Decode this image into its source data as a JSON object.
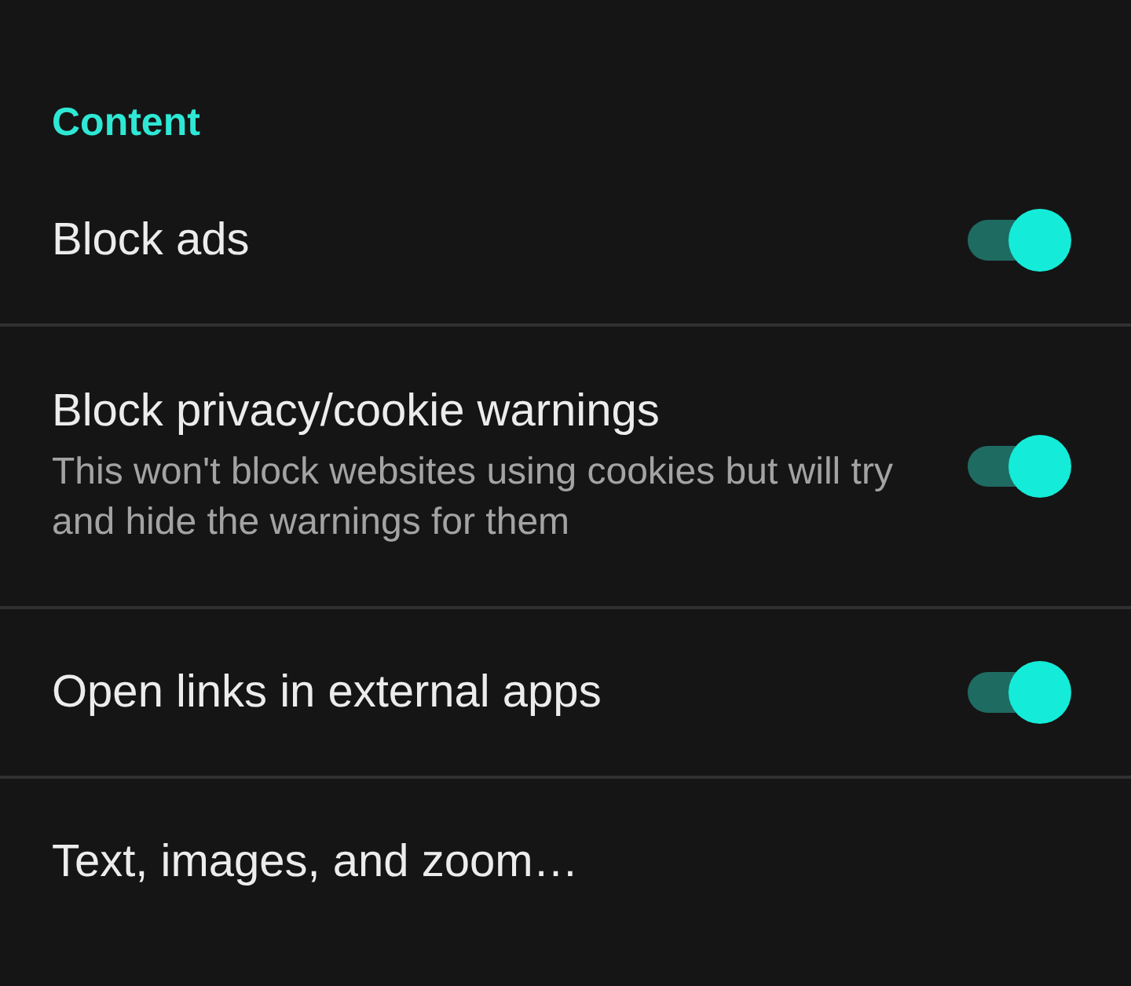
{
  "section": {
    "title": "Content"
  },
  "settings": [
    {
      "kind": "toggle",
      "title": "Block ads",
      "on": true
    },
    {
      "kind": "toggle",
      "title": "Block privacy/cookie warnings",
      "subtitle": "This won't block websites using cookies but will try and hide the warnings for them",
      "on": true
    },
    {
      "kind": "toggle",
      "title": "Open links in external apps",
      "on": true
    },
    {
      "kind": "link",
      "title": "Text, images, and zoom…"
    }
  ]
}
